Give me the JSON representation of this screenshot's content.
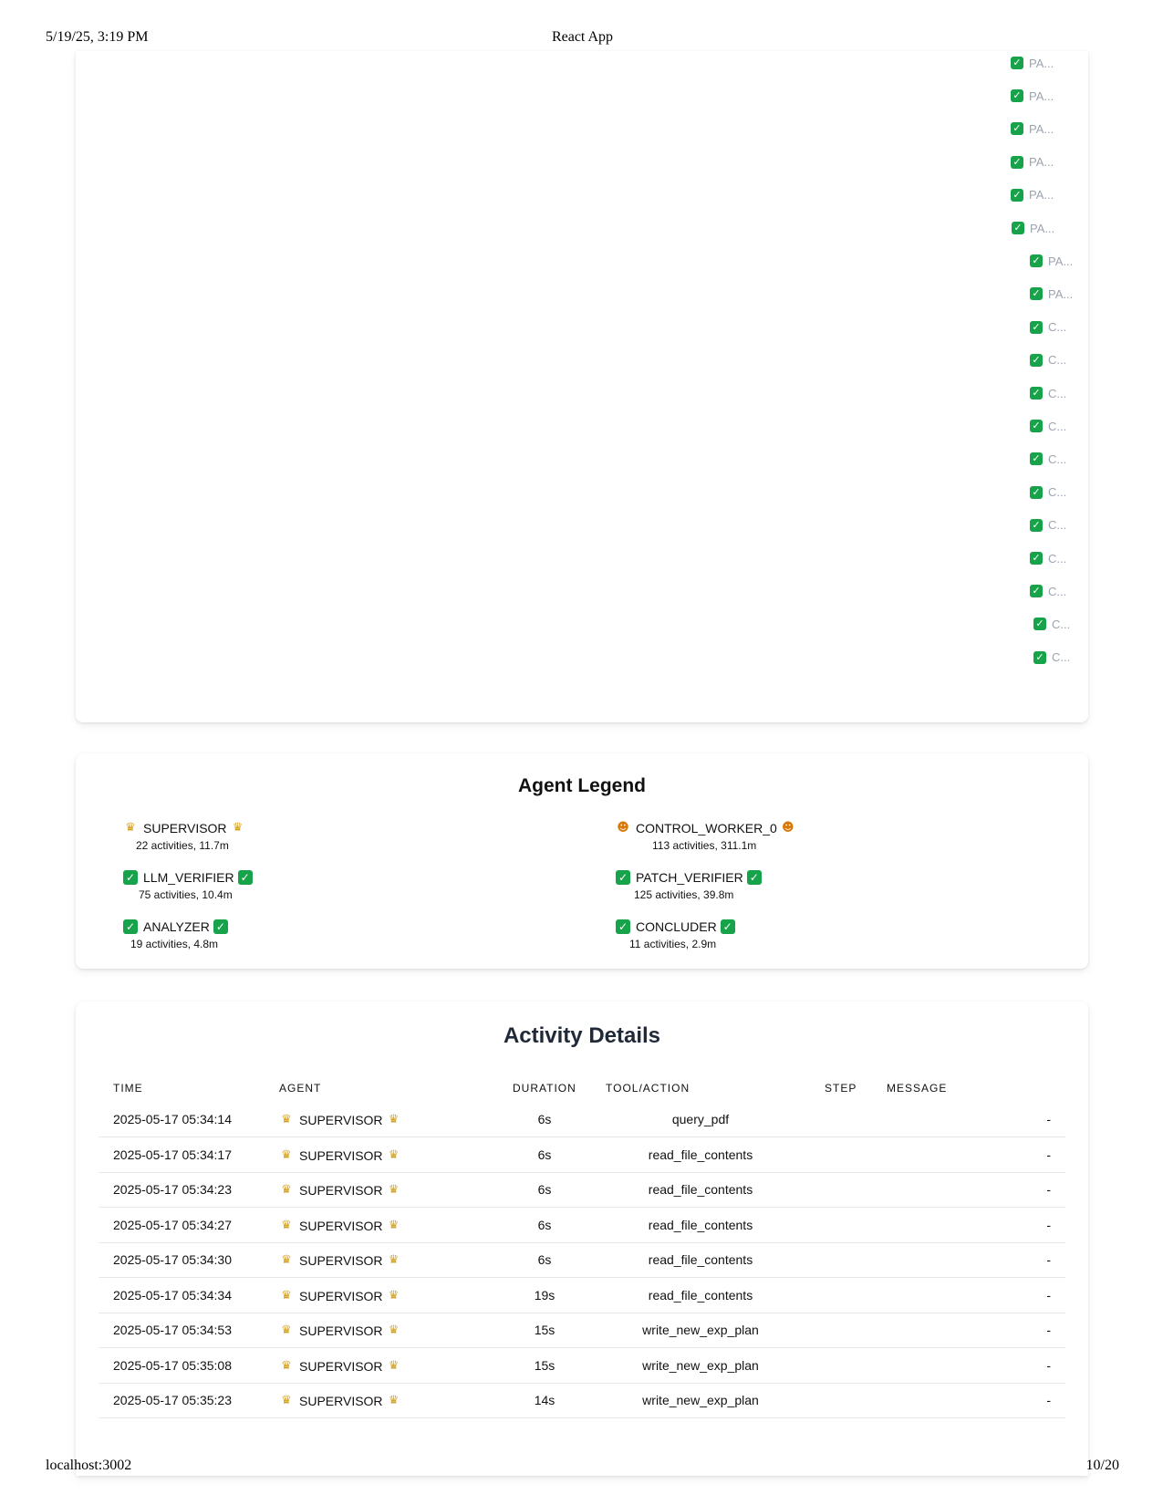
{
  "print_header": {
    "datetime": "5/19/25, 3:19 PM",
    "title": "React App"
  },
  "print_footer": {
    "url": "localhost:3002",
    "page": "10/20"
  },
  "timeline": {
    "labels": [
      "PA...",
      "PA...",
      "PA...",
      "PA...",
      "PA...",
      "PA...",
      "PA...",
      "PA...",
      "C...",
      "C...",
      "C...",
      "C...",
      "C...",
      "C...",
      "C...",
      "C...",
      "C...",
      "C...",
      "C..."
    ],
    "status_icon": "check-icon"
  },
  "legend": {
    "title": "Agent Legend",
    "agents": [
      {
        "name": "SUPERVISOR",
        "summary": "22 activities, 11.7m",
        "icon": "crown-icon"
      },
      {
        "name": "CONTROL_WORKER_0",
        "summary": "113 activities, 311.1m",
        "icon": "worker-icon"
      },
      {
        "name": "LLM_VERIFIER",
        "summary": "75 activities, 10.4m",
        "icon": "check-icon"
      },
      {
        "name": "PATCH_VERIFIER",
        "summary": "125 activities, 39.8m",
        "icon": "check-icon"
      },
      {
        "name": "ANALYZER",
        "summary": "19 activities, 4.8m",
        "icon": "check-icon"
      },
      {
        "name": "CONCLUDER",
        "summary": "11 activities, 2.9m",
        "icon": "check-icon"
      }
    ]
  },
  "activity": {
    "title": "Activity Details",
    "columns": [
      "TIME",
      "AGENT",
      "DURATION",
      "TOOL/ACTION",
      "STEP",
      "MESSAGE"
    ],
    "rows": [
      {
        "time": "2025-05-17 05:34:14",
        "agent": "SUPERVISOR",
        "duration": "6s",
        "tool": "query_pdf",
        "step": "",
        "message": "-"
      },
      {
        "time": "2025-05-17 05:34:17",
        "agent": "SUPERVISOR",
        "duration": "6s",
        "tool": "read_file_contents",
        "step": "",
        "message": "-"
      },
      {
        "time": "2025-05-17 05:34:23",
        "agent": "SUPERVISOR",
        "duration": "6s",
        "tool": "read_file_contents",
        "step": "",
        "message": "-"
      },
      {
        "time": "2025-05-17 05:34:27",
        "agent": "SUPERVISOR",
        "duration": "6s",
        "tool": "read_file_contents",
        "step": "",
        "message": "-"
      },
      {
        "time": "2025-05-17 05:34:30",
        "agent": "SUPERVISOR",
        "duration": "6s",
        "tool": "read_file_contents",
        "step": "",
        "message": "-"
      },
      {
        "time": "2025-05-17 05:34:34",
        "agent": "SUPERVISOR",
        "duration": "19s",
        "tool": "read_file_contents",
        "step": "",
        "message": "-"
      },
      {
        "time": "2025-05-17 05:34:53",
        "agent": "SUPERVISOR",
        "duration": "15s",
        "tool": "write_new_exp_plan",
        "step": "",
        "message": "-"
      },
      {
        "time": "2025-05-17 05:35:08",
        "agent": "SUPERVISOR",
        "duration": "15s",
        "tool": "write_new_exp_plan",
        "step": "",
        "message": "-"
      },
      {
        "time": "2025-05-17 05:35:23",
        "agent": "SUPERVISOR",
        "duration": "14s",
        "tool": "write_new_exp_plan",
        "step": "",
        "message": "-"
      }
    ]
  }
}
